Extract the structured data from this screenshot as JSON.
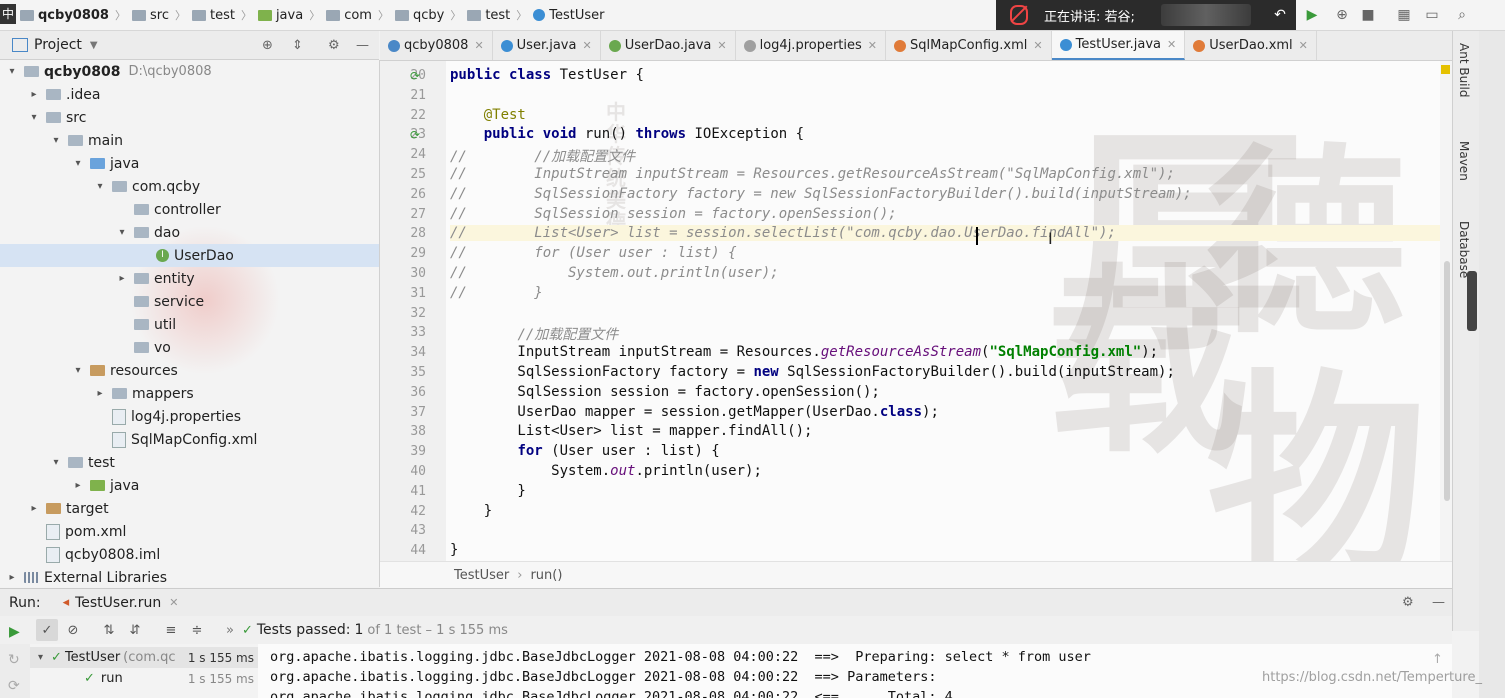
{
  "breadcrumb": [
    "qcby0808",
    "src",
    "test",
    "java",
    "com",
    "qcby",
    "test",
    "TestUser"
  ],
  "ime_indicator": "中",
  "speaking_banner": {
    "text": "正在讲话: 若谷;"
  },
  "project_panel": {
    "title": "Project",
    "tree": [
      {
        "label": "qcby0808",
        "extra": "D:\\qcby0808",
        "depth": 0,
        "arrow": "▾",
        "icon": "folder"
      },
      {
        "label": ".idea",
        "depth": 1,
        "arrow": "▸",
        "icon": "folder"
      },
      {
        "label": "src",
        "depth": 1,
        "arrow": "▾",
        "icon": "folder"
      },
      {
        "label": "main",
        "depth": 2,
        "arrow": "▾",
        "icon": "folder"
      },
      {
        "label": "java",
        "depth": 3,
        "arrow": "▾",
        "icon": "folder-blue"
      },
      {
        "label": "com.qcby",
        "depth": 4,
        "arrow": "▾",
        "icon": "folder"
      },
      {
        "label": "controller",
        "depth": 5,
        "arrow": "",
        "icon": "folder"
      },
      {
        "label": "dao",
        "depth": 5,
        "arrow": "▾",
        "icon": "folder"
      },
      {
        "label": "UserDao",
        "depth": 6,
        "arrow": "",
        "icon": "interface",
        "selected": true
      },
      {
        "label": "entity",
        "depth": 5,
        "arrow": "▸",
        "icon": "folder"
      },
      {
        "label": "service",
        "depth": 5,
        "arrow": "",
        "icon": "folder"
      },
      {
        "label": "util",
        "depth": 5,
        "arrow": "",
        "icon": "folder"
      },
      {
        "label": "vo",
        "depth": 5,
        "arrow": "",
        "icon": "folder"
      },
      {
        "label": "resources",
        "depth": 3,
        "arrow": "▾",
        "icon": "folder-orange"
      },
      {
        "label": "mappers",
        "depth": 4,
        "arrow": "▸",
        "icon": "folder"
      },
      {
        "label": "log4j.properties",
        "depth": 4,
        "arrow": "",
        "icon": "file"
      },
      {
        "label": "SqlMapConfig.xml",
        "depth": 4,
        "arrow": "",
        "icon": "file"
      },
      {
        "label": "test",
        "depth": 2,
        "arrow": "▾",
        "icon": "folder"
      },
      {
        "label": "java",
        "depth": 3,
        "arrow": "▸",
        "icon": "folder-green"
      },
      {
        "label": "target",
        "depth": 1,
        "arrow": "▸",
        "icon": "folder-orange"
      },
      {
        "label": "pom.xml",
        "depth": 1,
        "arrow": "",
        "icon": "file"
      },
      {
        "label": "qcby0808.iml",
        "depth": 1,
        "arrow": "",
        "icon": "file"
      },
      {
        "label": "External Libraries",
        "depth": 0,
        "arrow": "▸",
        "icon": "library"
      }
    ]
  },
  "editor_tabs": [
    {
      "label": "qcby0808",
      "color": "#4a88c7"
    },
    {
      "label": "User.java",
      "color": "#3b8ed4"
    },
    {
      "label": "UserDao.java",
      "color": "#6aa84f"
    },
    {
      "label": "log4j.properties",
      "color": "#a0a0a0"
    },
    {
      "label": "SqlMapConfig.xml",
      "color": "#e07b39"
    },
    {
      "label": "TestUser.java",
      "color": "#3b8ed4",
      "active": true
    },
    {
      "label": "UserDao.xml",
      "color": "#e07b39"
    }
  ],
  "code_lines": [
    {
      "n": "20",
      "mark": "run",
      "html": "<span class='kw'>public class</span> TestUser {"
    },
    {
      "n": "21",
      "html": ""
    },
    {
      "n": "22",
      "html": "    <span class='ann'>@Test</span>"
    },
    {
      "n": "23",
      "mark": "run",
      "html": "    <span class='kw'>public void</span> run() <span class='kw'>throws</span> IOException {"
    },
    {
      "n": "24",
      "html": "<span class='com'>//        //加载配置文件</span>"
    },
    {
      "n": "25",
      "html": "<span class='com'>//        InputStream inputStream = Resources.getResourceAsStream(\"SqlMapConfig.xml\");</span>"
    },
    {
      "n": "26",
      "html": "<span class='com'>//        SqlSessionFactory factory = new SqlSessionFactoryBuilder().build(inputStream);</span>"
    },
    {
      "n": "27",
      "html": "<span class='com'>//        SqlSession session = factory.openSession();</span>"
    },
    {
      "n": "28",
      "cur": true,
      "html": "<span class='com'>//        List&lt;User&gt; list = session.selectList(\"com.qcby.dao.UserDao.findAll\");</span>"
    },
    {
      "n": "29",
      "html": "<span class='com'>//        for (User user : list) {</span>"
    },
    {
      "n": "30",
      "html": "<span class='com'>//            System.out.println(user);</span>"
    },
    {
      "n": "31",
      "html": "<span class='com'>//        }</span>"
    },
    {
      "n": "32",
      "html": ""
    },
    {
      "n": "33",
      "html": "        <span class='com'>//加载配置文件</span>"
    },
    {
      "n": "34",
      "html": "        InputStream inputStream = Resources.<span class='st'>getResourceAsStream</span>(<span class='str'>\"SqlMapConfig.xml\"</span>);"
    },
    {
      "n": "35",
      "html": "        SqlSessionFactory factory = <span class='kw'>new</span> SqlSessionFactoryBuilder().build(inputStream);"
    },
    {
      "n": "36",
      "html": "        SqlSession session = factory.openSession();"
    },
    {
      "n": "37",
      "html": "        UserDao mapper = session.getMapper(UserDao.<span class='kw'>class</span>);"
    },
    {
      "n": "38",
      "html": "        List&lt;User&gt; list = mapper.findAll();"
    },
    {
      "n": "39",
      "html": "        <span class='kw'>for</span> (User user : list) {"
    },
    {
      "n": "40",
      "html": "            System.<span class='st'>out</span>.println(user);"
    },
    {
      "n": "41",
      "html": "        }"
    },
    {
      "n": "42",
      "html": "    }"
    },
    {
      "n": "43",
      "html": ""
    },
    {
      "n": "44",
      "html": "}"
    }
  ],
  "editor_breadcrumb": [
    "TestUser",
    "run()"
  ],
  "right_tools": [
    "Ant Build",
    "Maven",
    "Database"
  ],
  "run_panel": {
    "label": "Run:",
    "tab": "TestUser.run",
    "status_prefix": "Tests passed:",
    "status_count": "1",
    "status_suffix": "of 1 test – 1 s 155 ms",
    "tree": [
      {
        "label": "TestUser",
        "detail": "(com.qc",
        "time": "1 s 155 ms"
      },
      {
        "label": "run",
        "detail": "",
        "time": "1 s 155 ms"
      }
    ],
    "console_lines": [
      "org.apache.ibatis.logging.jdbc.BaseJdbcLogger 2021-08-08 04:00:22  ==>  Preparing: select * from user",
      "org.apache.ibatis.logging.jdbc.BaseJdbcLogger 2021-08-08 04:00:22  ==> Parameters: ",
      "org.apache.ibatis.logging.jdbc.BaseJdbcLogger 2021-08-08 04:00:22  <==      Total: 4"
    ]
  },
  "watermark": "https://blog.csdn.net/Temperture_",
  "colors": {
    "accent": "#4a88c7",
    "pass": "#3a9a3a",
    "keyword": "#000080",
    "string": "#008000"
  }
}
